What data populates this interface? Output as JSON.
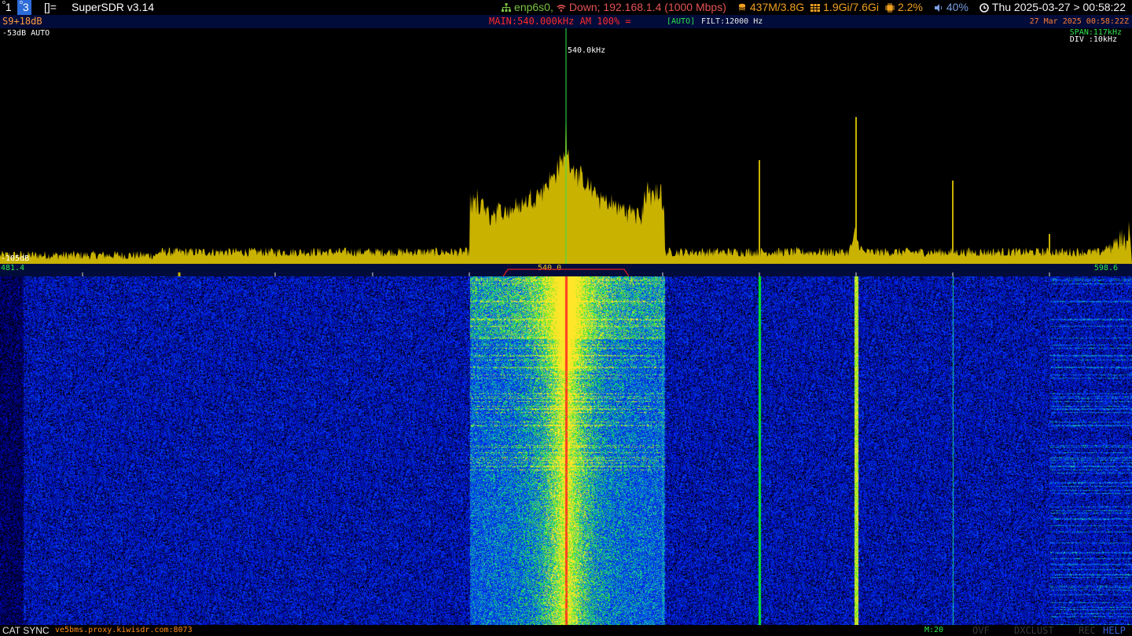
{
  "system_bar": {
    "workspace_1": "1",
    "workspace_3": "3",
    "layout_icon": "[]=",
    "window_title": "SuperSDR v3.14",
    "network": "enp6s0,",
    "network_status": "Down; 192.168.1.4 (1000 Mbps)",
    "disk": "437M/3.8G",
    "memory": "1.9Gi/7.6Gi",
    "cpu": "2.2%",
    "volume": "40%",
    "clock": "Thu 2025-03-27 > 00:58:22"
  },
  "sdr": {
    "s_meter": "S9+18dB",
    "main_freq": "MAIN:540.000kHz AM 100% =",
    "auto_badge": "[AUTO]",
    "filter": "FILT:12000 Hz",
    "datetime": "27 Mar 2025 00:58:22Z",
    "ref_top": "-53dB AUTO",
    "ref_bottom": "-105dB",
    "span": "SPAN:117kHz",
    "div": "DIV :10kHz",
    "tune_label": "540.0kHz",
    "scale_left": "481.4",
    "scale_right": "598.6",
    "scale_center": "540.0"
  },
  "status_bar": {
    "cat_sync": "CAT SYNC",
    "host": "ve5bms.proxy.kiwisdr.com:8073",
    "memory_count": "M:20",
    "ovf": "OVF",
    "dxclust": "DXCLUST",
    "rec": "REC",
    "help": "HELP"
  },
  "colors": {
    "spectrum_fill": "#c9b200",
    "tuning_line": "#2ee64e",
    "passband": "#e0201e",
    "info_bg": "#020c3a",
    "waterfall_noise": "#0a1a8a"
  }
}
